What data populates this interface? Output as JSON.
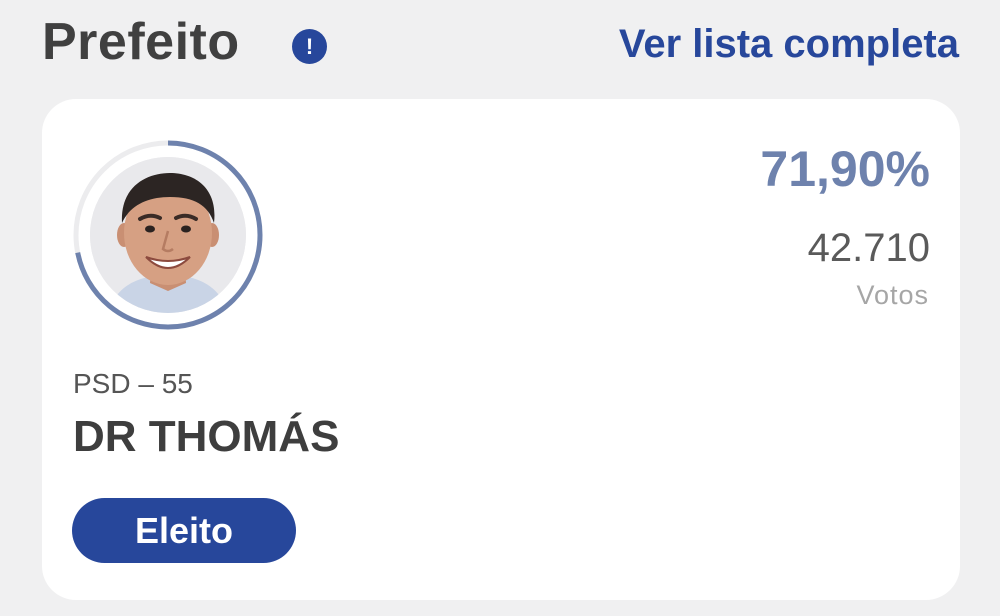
{
  "header": {
    "title": "Prefeito",
    "info_icon": "info-icon",
    "info_glyph": "!",
    "see_all_label": "Ver lista completa"
  },
  "candidate": {
    "party": "PSD – 55",
    "name": "DR THOMÁS",
    "percent": "71,90%",
    "percent_value": 71.9,
    "votes": "42.710",
    "votes_label": "Votos",
    "status": "Eleito",
    "avatar": "candidate-photo"
  },
  "colors": {
    "accent": "#27479b",
    "ring": "#6e82ad",
    "ring_track": "#ececee",
    "background": "#f0f0f1",
    "card": "#ffffff"
  }
}
